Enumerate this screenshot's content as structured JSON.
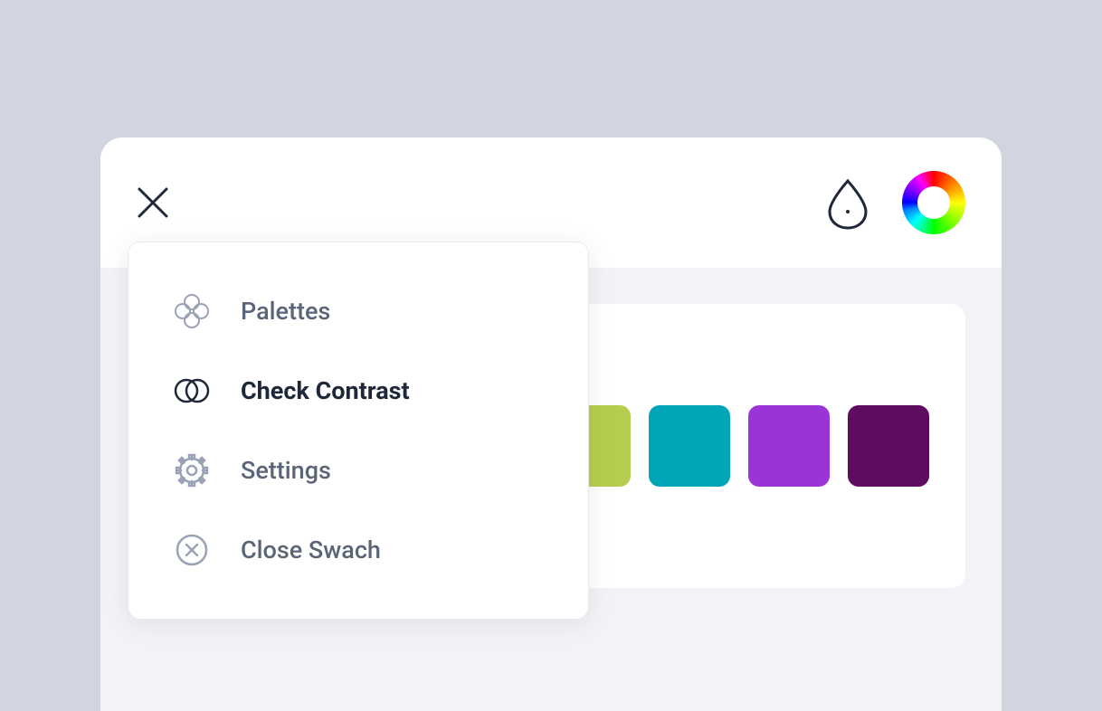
{
  "menu": {
    "items": [
      {
        "label": "Palettes",
        "icon": "palettes-icon",
        "active": false
      },
      {
        "label": "Check Contrast",
        "icon": "contrast-icon",
        "active": true
      },
      {
        "label": "Settings",
        "icon": "gear-icon",
        "active": false
      },
      {
        "label": "Close Swach",
        "icon": "close-circle-icon",
        "active": false
      }
    ]
  },
  "palette": {
    "swatches": [
      {
        "color": "#b5cd4e"
      },
      {
        "color": "#00a6b8"
      },
      {
        "color": "#9b34d6"
      },
      {
        "color": "#5f0b5f"
      }
    ]
  }
}
